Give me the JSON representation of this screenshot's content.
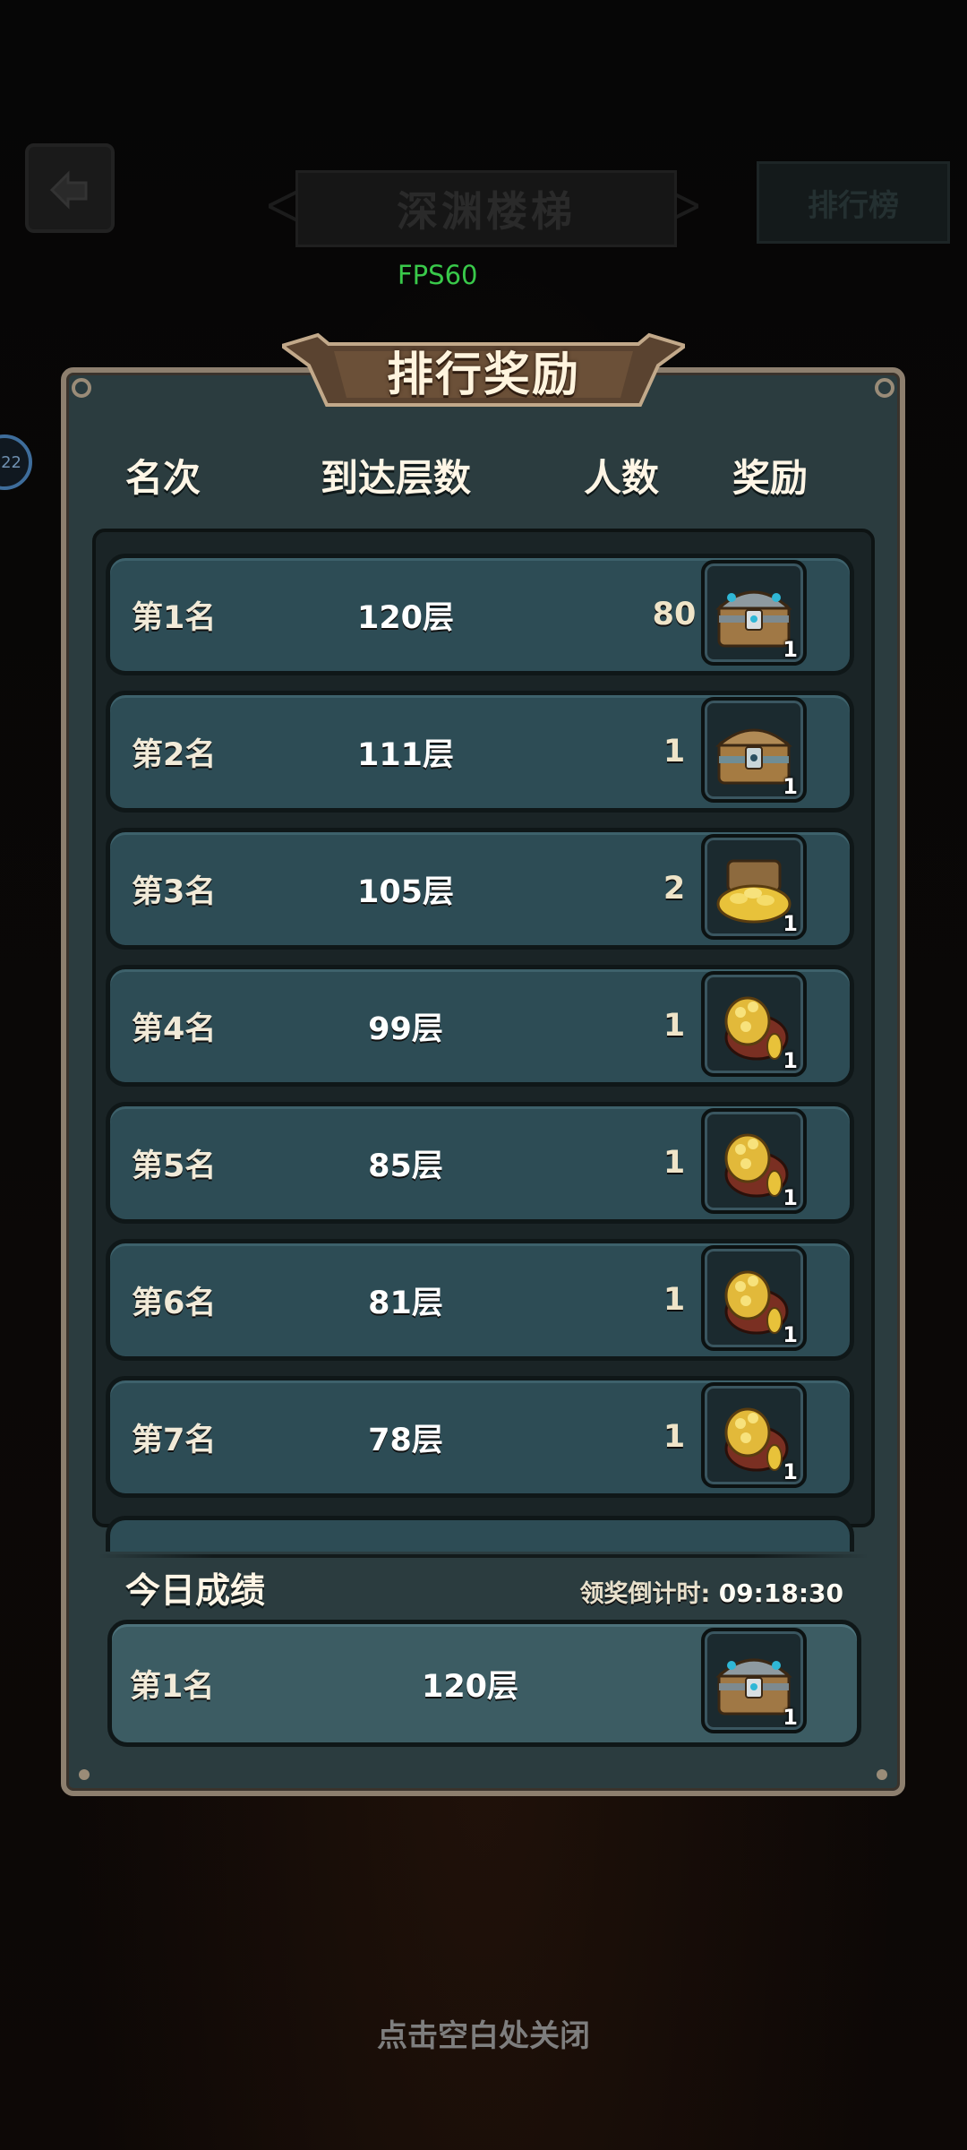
{
  "background": {
    "title": "深渊楼梯",
    "rank_button": "排行榜",
    "badge_text": "22"
  },
  "fps": "FPS60",
  "panel": {
    "title": "排行奖励",
    "headers": {
      "rank": "名次",
      "floor": "到达层数",
      "count": "人数",
      "reward": "奖励"
    },
    "rows": [
      {
        "rank": "第1名",
        "floor": "120层",
        "count": "80",
        "reward_icon": "treasure-chest-icon",
        "reward_qty": "1"
      },
      {
        "rank": "第2名",
        "floor": "111层",
        "count": "1",
        "reward_icon": "treasure-chest-icon",
        "reward_qty": "1"
      },
      {
        "rank": "第3名",
        "floor": "105层",
        "count": "2",
        "reward_icon": "gold-pile-chest-icon",
        "reward_qty": "1"
      },
      {
        "rank": "第4名",
        "floor": "99层",
        "count": "1",
        "reward_icon": "gold-bag-icon",
        "reward_qty": "1"
      },
      {
        "rank": "第5名",
        "floor": "85层",
        "count": "1",
        "reward_icon": "gold-bag-icon",
        "reward_qty": "1"
      },
      {
        "rank": "第6名",
        "floor": "81层",
        "count": "1",
        "reward_icon": "gold-bag-icon",
        "reward_qty": "1"
      },
      {
        "rank": "第7名",
        "floor": "78层",
        "count": "1",
        "reward_icon": "gold-bag-icon",
        "reward_qty": "1"
      }
    ],
    "today": {
      "label": "今日成绩",
      "countdown_label": "领奖倒计时:",
      "countdown_value": "09:18:30",
      "rank": "第1名",
      "floor": "120层",
      "reward_icon": "treasure-chest-icon",
      "reward_qty": "1"
    }
  },
  "close_hint": "点击空白处关闭",
  "colors": {
    "panel": "#2b3c3f",
    "row": "#2d4c55",
    "frame": "#8d7f6e",
    "fps": "#39c94a"
  }
}
